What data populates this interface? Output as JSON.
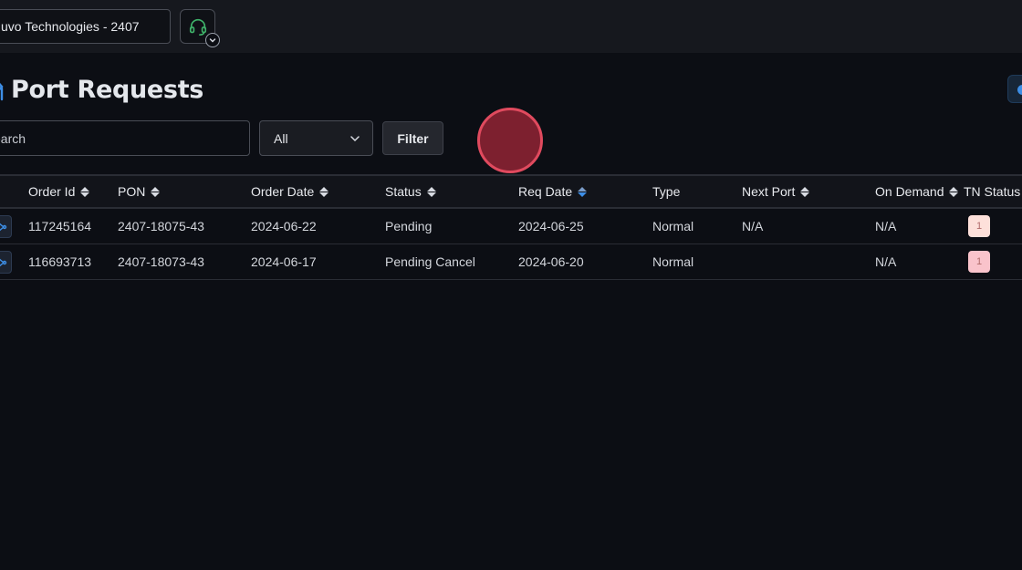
{
  "header": {
    "account": "uvo Technologies - 2407"
  },
  "page": {
    "title": "Port Requests"
  },
  "filters": {
    "search_placeholder": "earch",
    "status_value": "All",
    "filter_label": "Filter"
  },
  "table": {
    "columns": [
      {
        "label": "Order Id",
        "sortable": true
      },
      {
        "label": "PON",
        "sortable": true
      },
      {
        "label": "Order Date",
        "sortable": true
      },
      {
        "label": "Status",
        "sortable": true
      },
      {
        "label": "Req Date",
        "sortable": true,
        "sorted": "desc"
      },
      {
        "label": "Type",
        "sortable": false
      },
      {
        "label": "Next Port",
        "sortable": true
      },
      {
        "label": "On Demand",
        "sortable": true
      },
      {
        "label": "TN Status",
        "sortable": false
      }
    ],
    "rows": [
      {
        "order_id": "117245164",
        "pon": "2407-18075-43",
        "order_date": "2024-06-22",
        "status": "Pending",
        "req_date": "2024-06-25",
        "type": "Normal",
        "next_port": "N/A",
        "on_demand": "N/A",
        "tn_status": "1",
        "tn_color": "#fde0da"
      },
      {
        "order_id": "116693713",
        "pon": "2407-18073-43",
        "order_date": "2024-06-17",
        "status": "Pending Cancel",
        "req_date": "2024-06-20",
        "type": "Normal",
        "next_port": "",
        "on_demand": "N/A",
        "tn_status": "1",
        "tn_color": "#f9c3cb"
      }
    ]
  },
  "colors": {
    "background": "#0c0e14",
    "topbar": "#16181e",
    "accent": "#3d8ee6",
    "click_indicator": "#842230"
  }
}
